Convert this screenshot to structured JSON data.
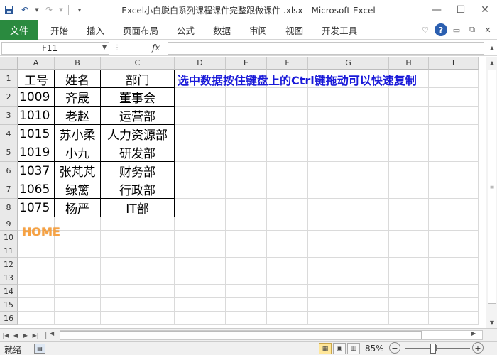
{
  "window": {
    "title": "Excel小白脱白系列课程课件完整跟做课件 .xlsx  -  Microsoft Excel",
    "qat": {
      "save_icon": "save-icon",
      "undo_icon": "undo-icon",
      "redo_icon": "redo-icon",
      "customize_icon": "customize-icon"
    },
    "controls": {
      "minimize": "—",
      "restore": "☐",
      "close": "✕"
    }
  },
  "ribbon": {
    "file_tab": "文件",
    "tabs": [
      "开始",
      "插入",
      "页面布局",
      "公式",
      "数据",
      "审阅",
      "视图",
      "开发工具"
    ]
  },
  "formula_bar": {
    "name_box": "F11",
    "fx_label": "fx",
    "formula": ""
  },
  "grid": {
    "columns": [
      "A",
      "B",
      "C",
      "D",
      "E",
      "F",
      "G",
      "H",
      "I"
    ],
    "rows": [
      "1",
      "2",
      "3",
      "4",
      "5",
      "6",
      "7",
      "8",
      "9",
      "10",
      "11",
      "12",
      "13",
      "14",
      "15",
      "16"
    ],
    "table": [
      [
        "工号",
        "姓名",
        "部门"
      ],
      [
        "1009",
        "齐晟",
        "董事会"
      ],
      [
        "1010",
        "老赵",
        "运营部"
      ],
      [
        "1015",
        "苏小柔",
        "人力资源部"
      ],
      [
        "1019",
        "小九",
        "研发部"
      ],
      [
        "1037",
        "张芃芃",
        "财务部"
      ],
      [
        "1065",
        "绿篱",
        "行政部"
      ],
      [
        "1075",
        "杨严",
        "IT部"
      ]
    ],
    "instruction": "选中数据按住键盘上的Ctrl键拖动可以快速复制",
    "home_link": "HOME"
  },
  "status": {
    "ready": "就绪",
    "zoom": "85%",
    "zoom_fraction": 0.43,
    "minus": "−",
    "plus": "+"
  }
}
